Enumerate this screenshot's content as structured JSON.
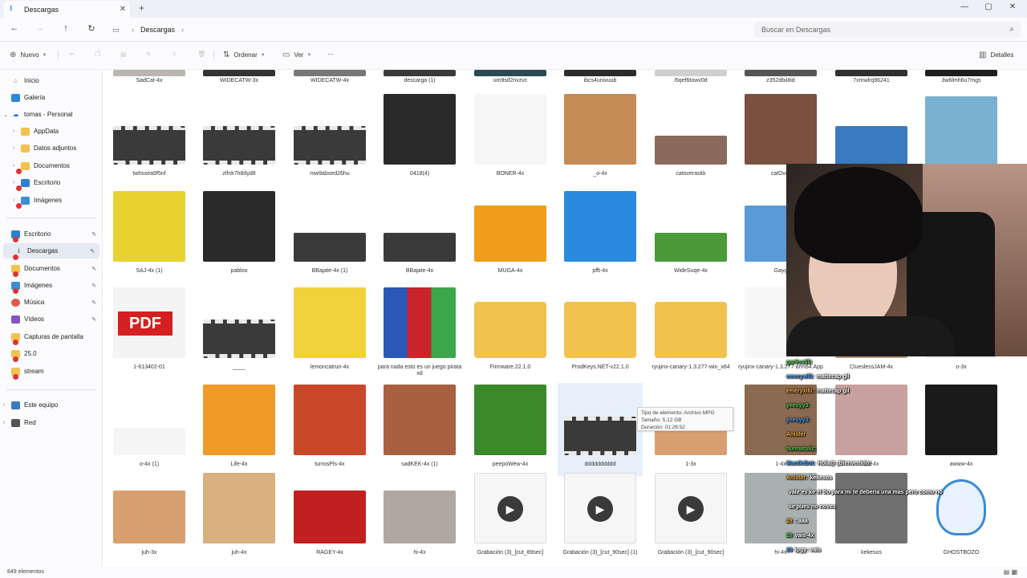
{
  "window": {
    "tab_title": "Descargas",
    "tab_icon": "download-icon",
    "new_tab_symbol": "+",
    "controls": [
      "—",
      "▢",
      "✕"
    ]
  },
  "address": {
    "breadcrumb": [
      "Descargas"
    ],
    "search_placeholder": "Buscar en Descargas"
  },
  "commands": {
    "new_label": "Nuevo",
    "sort_label": "Ordenar",
    "view_label": "Ver",
    "more_label": "···",
    "details_label": "Detalles"
  },
  "sidebar": {
    "top": [
      {
        "label": "Inicio",
        "icon": "home-icon"
      },
      {
        "label": "Galería",
        "icon": "gallery-icon"
      },
      {
        "label": "tomas - Personal",
        "icon": "cloud-icon"
      }
    ],
    "cloud": [
      {
        "label": "AppData",
        "icon": "folder-icon"
      },
      {
        "label": "Datos adjuntos",
        "icon": "folder-icon"
      },
      {
        "label": "Documentos",
        "icon": "folder-icon"
      },
      {
        "label": "Escritorio",
        "icon": "desktop-icon"
      },
      {
        "label": "Imágenes",
        "icon": "pictures-icon"
      }
    ],
    "quick": [
      {
        "label": "Escritorio",
        "icon": "desktop-icon"
      },
      {
        "label": "Descargas",
        "icon": "download-icon"
      },
      {
        "label": "Documentos",
        "icon": "documents-icon"
      },
      {
        "label": "Imágenes",
        "icon": "pictures-icon"
      },
      {
        "label": "Música",
        "icon": "music-icon"
      },
      {
        "label": "Vídeos",
        "icon": "videos-icon"
      },
      {
        "label": "Capturas de pantalla",
        "icon": "folder-icon"
      },
      {
        "label": "25.0",
        "icon": "folder-icon"
      },
      {
        "label": "stream",
        "icon": "folder-icon"
      }
    ],
    "bottom": [
      {
        "label": "Este equipo",
        "icon": "pc-icon"
      },
      {
        "label": "Red",
        "icon": "network-icon"
      }
    ]
  },
  "files": {
    "row0": [
      "SadCat-4x",
      "WIDECATW-3x",
      "WIDECATW-4x",
      "descarga (1)",
      "um9sif2nvzvc",
      "ibcs4unixuub",
      "i5qef6towv0d",
      "z352dbii8id",
      "7xmwlrq96241",
      "3w6lmh6u7mgs"
    ],
    "row1": [
      "twhsxea9f5nf",
      "zlfnk7h8dyd8",
      "mw9absed26hu",
      "0418(4)",
      "BONER-4x",
      "_o-4x",
      "catoveraskk",
      "catOver",
      "",
      ""
    ],
    "row2": [
      "SAJ-4x (1)",
      "pabloo",
      "BBajate-4x (1)",
      "BBajate-4x",
      "MUGA-4x",
      "pfft-4x",
      "WideSuqe-4x",
      "Gayg",
      "",
      ""
    ],
    "row3": [
      "1-613402-01",
      "____",
      "lemoncatrun-4x",
      "para nada esto es un juego pirata xd",
      "Firmware.22.1.0",
      "ProdKeys.NET-v22.1.0",
      "ryujinx-canary-1.3.277-win_x64",
      "ryujinx-canary-1.3.277-arm64.App",
      "ClueslessJAM-4x",
      "o-3x"
    ],
    "row4": [
      "o-4x (1)",
      "Life-4x",
      "turrosPls-4x",
      "sadKEK-4x (1)",
      "peepoWew-4x",
      "dddddddddd",
      "1-3x",
      "1-4x",
      "cat-4x",
      "awww-4x"
    ],
    "row5": [
      "juh-3x",
      "juh-4x",
      "RAGEY-4x",
      "hi-4x",
      "Grabación (3)_[cut_89sec]",
      "Grabación (3)_[cut_90sec] (1)",
      "Grabación (3)_[cut_90sec]",
      "hi-4x",
      "kekesos",
      "GHOSTBOZO"
    ]
  },
  "tooltip": {
    "line1": "Tipo de elemento: Archivo MPG",
    "line2": "Tamaño: 5,12 GB",
    "line3": "Duración: 01:26:52"
  },
  "status": {
    "count": "849 elementos"
  },
  "chat": [
    {
      "user": "gar9ssilli:",
      "msg": ""
    },
    {
      "user": "emeryxilli:",
      "msg": "mattecap gil"
    },
    {
      "user": "emeryxilli:",
      "msg": "mattecap gil"
    },
    {
      "user": "yeesyy3:",
      "msg": ""
    },
    {
      "user": "yeesyy3:",
      "msg": ""
    },
    {
      "user": "Anister",
      "msg": ""
    },
    {
      "user": "bunnatuliz:",
      "msg": ""
    },
    {
      "user": "MantleBot:",
      "msg": "Hola@ ¡Bienvenido!"
    },
    {
      "user": "Anister:",
      "msg": "kekesos"
    },
    {
      "user": "",
      "msg": "vale es ke el tio para mi te deberia una mas pero como no"
    },
    {
      "user": "",
      "msg": "se pues no noves"
    },
    {
      "user": "28",
      "msg": ": aaa"
    },
    {
      "user": "28",
      "msg": "vais-4x"
    },
    {
      "user": "28",
      "msg": "ipgy: vais"
    }
  ],
  "colors": {
    "accent": "#1a73e8",
    "folder": "#f2c14e",
    "bg": "#ffffff",
    "sidebar_active": "#e5e9f1"
  }
}
